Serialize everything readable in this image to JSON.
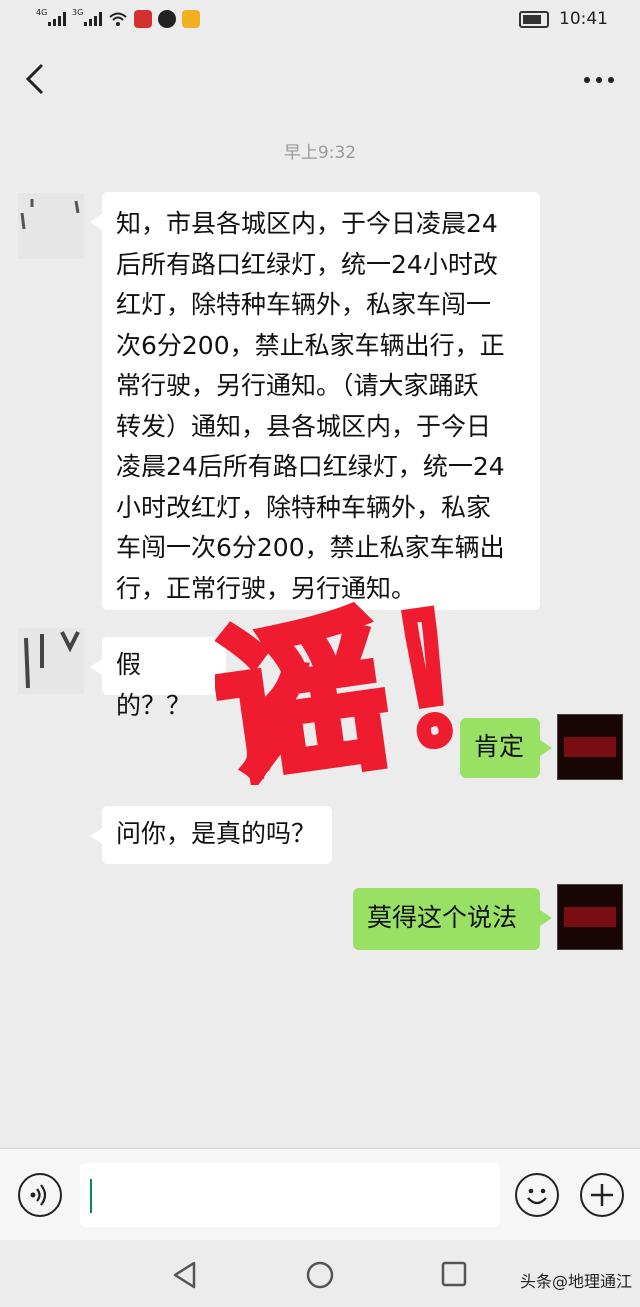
{
  "status_bar": {
    "sim1_network": "4G",
    "sim2_network": "3G",
    "time": "10:41"
  },
  "chat": {
    "timestamp": "早上9:32",
    "messages": [
      {
        "side": "left",
        "lines": [
          "知，市县各城区内，于今日凌晨24",
          "后所有路口红绿灯，统一24小时改",
          "红灯，除特种车辆外，私家车闯一",
          "次6分200，禁止私家车辆出行，正",
          "常行驶，另行通知。（请大家踊跃",
          "转发）通知，县各城区内，于今日",
          "凌晨24后所有路口红绿灯，统一24",
          "小时改红灯，除特种车辆外，私家",
          "车闯一次6分200，禁止私家车辆出",
          "行，正常行驶，另行通知。"
        ]
      },
      {
        "side": "left",
        "text": "假的？？"
      },
      {
        "side": "right",
        "text": "肯定"
      },
      {
        "side": "left",
        "text": "问你，是真的吗？"
      },
      {
        "side": "right",
        "text": "莫得这个说法"
      }
    ]
  },
  "stamp_text": "谣！",
  "watermark": "头条@地理通江",
  "colors": {
    "background": "#ececec",
    "bubble_left": "#ffffff",
    "bubble_right": "#98e165",
    "stamp_red": "#ee1c2e"
  },
  "icons": [
    "back-arrow-icon",
    "more-icon",
    "voice-icon",
    "emoji-icon",
    "plus-icon",
    "nav-back-icon",
    "nav-home-icon",
    "nav-recent-icon"
  ]
}
